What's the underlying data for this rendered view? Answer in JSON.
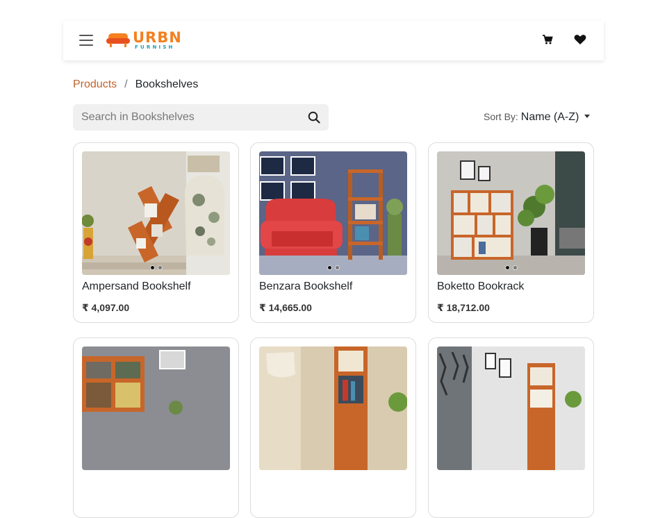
{
  "brand": {
    "main": "URBN",
    "sub": "FURNISH",
    "orange": "#f4801f",
    "teal": "#1d9fb0"
  },
  "header": {
    "menu_icon": "hamburger-icon",
    "cart_icon": "cart-icon",
    "wishlist_icon": "heart-icon"
  },
  "breadcrumb": {
    "parent": "Products",
    "separator": "/",
    "current": "Bookshelves"
  },
  "search": {
    "placeholder": "Search in Bookshelves",
    "value": "",
    "icon": "search-icon"
  },
  "sort": {
    "label": "Sort By:",
    "value": "Name (A-Z)"
  },
  "products": [
    {
      "name": "Ampersand Bookshelf",
      "price": "₹ 4,097.00"
    },
    {
      "name": "Benzara Bookshelf",
      "price": "₹ 14,665.00"
    },
    {
      "name": "Boketto Bookrack",
      "price": "₹ 18,712.00"
    },
    {
      "name": "",
      "price": ""
    },
    {
      "name": "",
      "price": ""
    },
    {
      "name": "",
      "price": ""
    }
  ],
  "colors": {
    "link": "#c0622b",
    "wood": "#c8662a"
  }
}
